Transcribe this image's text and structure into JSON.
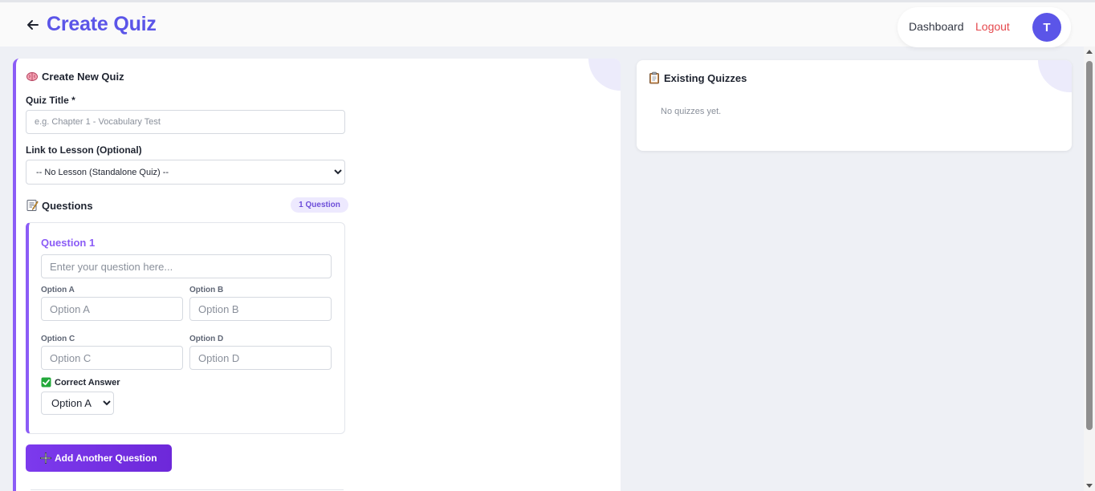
{
  "header": {
    "title": "Create Quiz",
    "nav": {
      "dashboard": "Dashboard",
      "logout": "Logout"
    },
    "avatar_initial": "T"
  },
  "create_panel": {
    "title": "Create New Quiz",
    "quiz_title_label": "Quiz Title *",
    "quiz_title_placeholder": "e.g. Chapter 1 - Vocabulary Test",
    "lesson_label": "Link to Lesson (Optional)",
    "lesson_selected": "-- No Lesson (Standalone Quiz) --",
    "questions_title": "Questions",
    "questions_badge": "1 Question",
    "question": {
      "title": "Question 1",
      "question_placeholder": "Enter your question here...",
      "option_a_label": "Option A",
      "option_a_placeholder": "Option A",
      "option_b_label": "Option B",
      "option_b_placeholder": "Option B",
      "option_c_label": "Option C",
      "option_c_placeholder": "Option C",
      "option_d_label": "Option D",
      "option_d_placeholder": "Option D",
      "correct_label": "Correct Answer",
      "correct_selected": "Option A"
    },
    "add_button": "Add Another Question"
  },
  "existing_panel": {
    "title": "Existing Quizzes",
    "empty_text": "No quizzes yet."
  },
  "colors": {
    "accent": "#5b55e8",
    "purple": "#8b5cf6",
    "logout": "#e5484d",
    "background": "#eef0f5"
  }
}
